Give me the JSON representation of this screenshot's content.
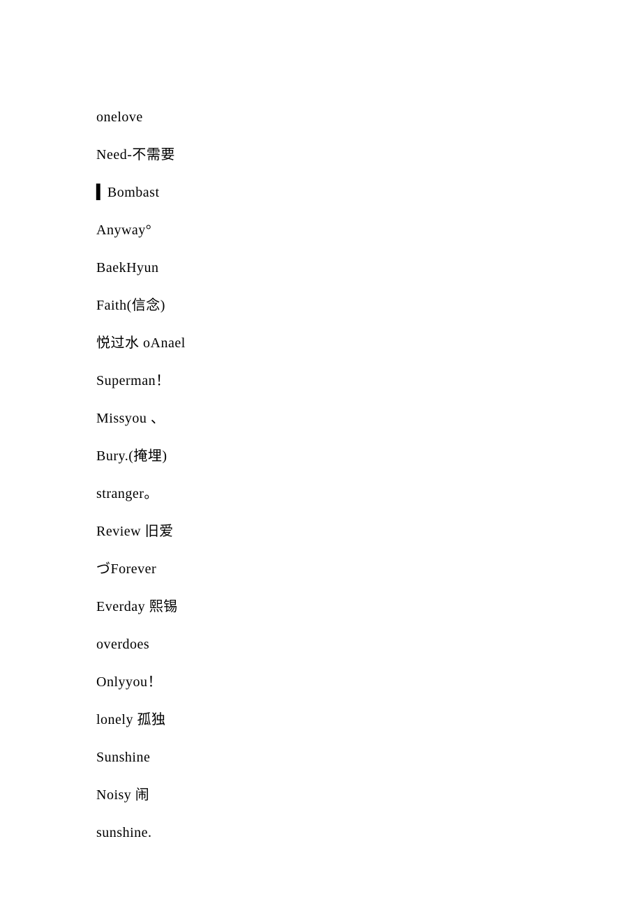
{
  "lines": [
    "onelove",
    "Need-不需要",
    "▍Bombast",
    "Anyway°",
    "BaekHyun",
    "Faith(信念)",
    "悦过水 oAnael",
    "Superman！",
    "Missyou 、",
    "Bury.(掩埋)",
    "stranger。",
    "Review 旧爱",
    "づForever",
    "Everday 熙锡",
    "overdoes",
    "Onlyyou！",
    "lonely 孤独",
    "Sunshine",
    "Noisy 闹",
    "sunshine."
  ]
}
